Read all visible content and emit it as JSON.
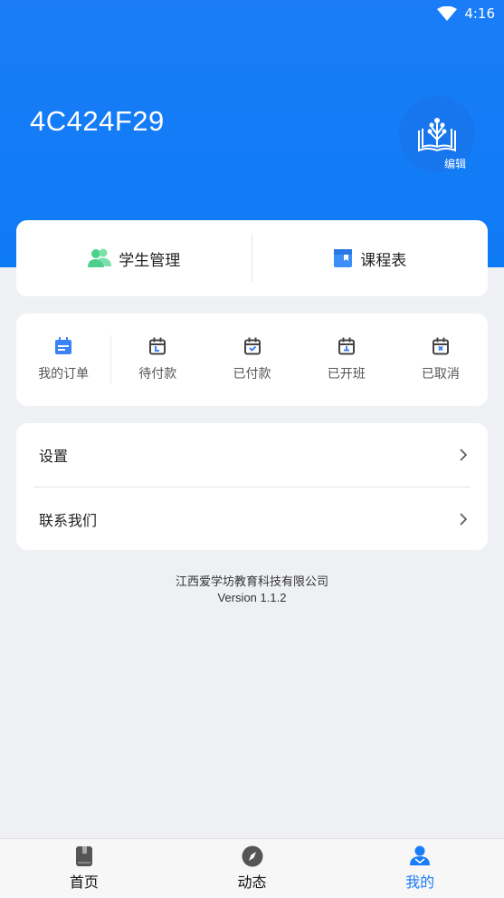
{
  "status_bar": {
    "time": "4:16"
  },
  "profile": {
    "name": "4C424F29",
    "edit_label": "编辑"
  },
  "quick_actions": [
    {
      "label": "学生管理",
      "icon": "users-icon"
    },
    {
      "label": "课程表",
      "icon": "schedule-book-icon"
    }
  ],
  "orders": [
    {
      "label": "我的订单",
      "icon": "calendar-icon",
      "accent": "#3b82f6"
    },
    {
      "label": "待付款",
      "icon": "calendar-icon"
    },
    {
      "label": "已付款",
      "icon": "calendar-check-icon"
    },
    {
      "label": "已开班",
      "icon": "calendar-icon"
    },
    {
      "label": "已取消",
      "icon": "calendar-x-icon"
    }
  ],
  "menu": [
    {
      "label": "设置"
    },
    {
      "label": "联系我们"
    }
  ],
  "footer": {
    "company": "江西爱学坊教育科技有限公司",
    "version": "Version 1.1.2"
  },
  "tabs": [
    {
      "label": "首页",
      "icon": "book-icon"
    },
    {
      "label": "动态",
      "icon": "compass-icon"
    },
    {
      "label": "我的",
      "icon": "person-icon",
      "active": true
    }
  ],
  "colors": {
    "primary": "#1a7df7",
    "users_icon": "#4cd08b",
    "background": "#eef0f4"
  }
}
